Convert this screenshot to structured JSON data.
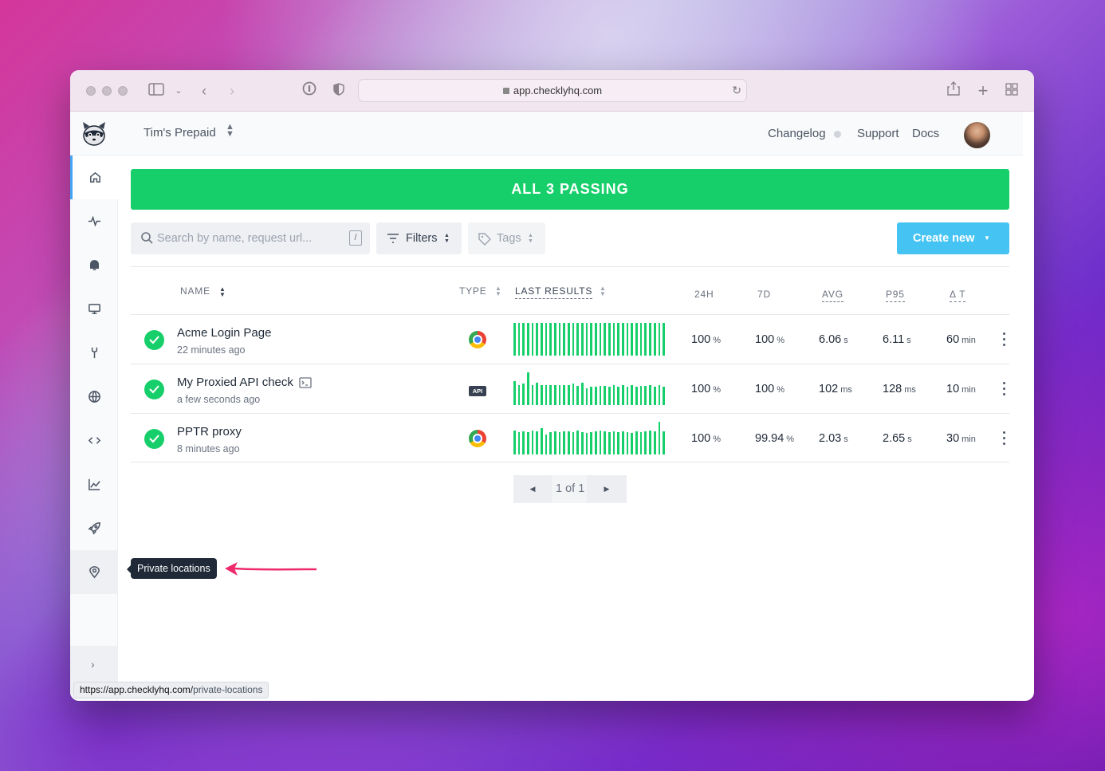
{
  "browser": {
    "url": "app.checklyhq.com",
    "status_url_prefix": "https://app.checklyhq.com/",
    "status_url_path": "private-locations"
  },
  "header": {
    "account_name": "Tim's Prepaid",
    "links": [
      "Changelog",
      "Support",
      "Docs"
    ]
  },
  "sidebar": {
    "items": [
      {
        "icon": "home-icon",
        "active": true
      },
      {
        "icon": "activity-icon"
      },
      {
        "icon": "bell-icon"
      },
      {
        "icon": "monitor-icon"
      },
      {
        "icon": "wrench-icon"
      },
      {
        "icon": "globe-icon"
      },
      {
        "icon": "code-icon"
      },
      {
        "icon": "chart-icon"
      },
      {
        "icon": "rocket-icon"
      },
      {
        "icon": "map-pin-icon",
        "hover": true
      }
    ],
    "tooltip": "Private locations"
  },
  "banner": {
    "text": "ALL 3 PASSING",
    "color": "#17cf6a"
  },
  "toolbar": {
    "search_placeholder": "Search by name, request url...",
    "search_shortcut": "/",
    "filters_label": "Filters",
    "tags_label": "Tags",
    "create_label": "Create new"
  },
  "table": {
    "columns": [
      "NAME",
      "TYPE",
      "LAST RESULTS",
      "24H",
      "7D",
      "AVG",
      "P95",
      "Δ T"
    ],
    "rows": [
      {
        "name": "Acme Login Page",
        "time": "22 minutes ago",
        "type": "browser",
        "h24": "100",
        "h24_unit": "%",
        "d7": "100",
        "d7_unit": "%",
        "avg": "6.06",
        "avg_unit": "s",
        "p95": "6.11",
        "p95_unit": "s",
        "dt": "60",
        "dt_unit": "min",
        "results": [
          1,
          1,
          1,
          1,
          1,
          1,
          1,
          1,
          1,
          1,
          1,
          1,
          1,
          1,
          1,
          1,
          1,
          1,
          1,
          1,
          1,
          1,
          1,
          1,
          1,
          1,
          1,
          1,
          1,
          1,
          1,
          1,
          1,
          1
        ]
      },
      {
        "name": "My Proxied API check",
        "time": "a few seconds ago",
        "type": "api",
        "type_label": "API",
        "h24": "100",
        "h24_unit": "%",
        "d7": "100",
        "d7_unit": "%",
        "avg": "102",
        "avg_unit": "ms",
        "p95": "128",
        "p95_unit": "ms",
        "dt": "10",
        "dt_unit": "min",
        "results": [
          0.72,
          0.6,
          0.65,
          1.0,
          0.62,
          0.68,
          0.6,
          0.62,
          0.6,
          0.6,
          0.6,
          0.62,
          0.6,
          0.65,
          0.58,
          0.68,
          0.5,
          0.55,
          0.55,
          0.58,
          0.58,
          0.55,
          0.62,
          0.56,
          0.62,
          0.56,
          0.6,
          0.55,
          0.58,
          0.58,
          0.6,
          0.55,
          0.6,
          0.55
        ]
      },
      {
        "name": "PPTR proxy",
        "time": "8 minutes ago",
        "type": "browser",
        "h24": "100",
        "h24_unit": "%",
        "d7": "99.94",
        "d7_unit": "%",
        "avg": "2.03",
        "avg_unit": "s",
        "p95": "2.65",
        "p95_unit": "s",
        "dt": "30",
        "dt_unit": "min",
        "results": [
          0.72,
          0.68,
          0.7,
          0.68,
          0.72,
          0.7,
          0.8,
          0.6,
          0.68,
          0.7,
          0.68,
          0.7,
          0.7,
          0.68,
          0.72,
          0.68,
          0.65,
          0.68,
          0.7,
          0.72,
          0.7,
          0.68,
          0.7,
          0.68,
          0.7,
          0.68,
          0.65,
          0.7,
          0.68,
          0.7,
          0.72,
          0.7,
          1.0,
          0.7
        ]
      }
    ]
  },
  "pagination": {
    "text": "1 of 1"
  }
}
